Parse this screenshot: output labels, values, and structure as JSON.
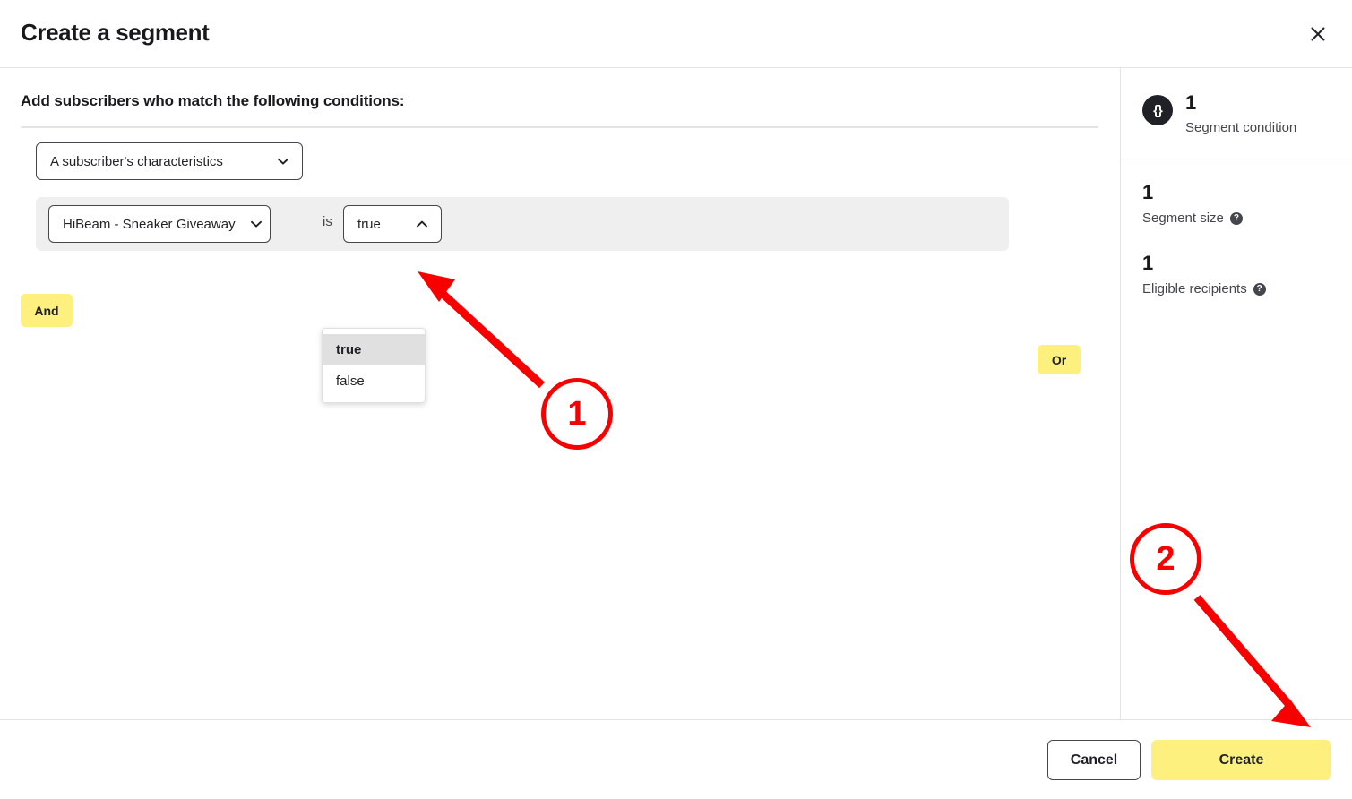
{
  "header": {
    "title": "Create a segment",
    "close_icon": "close-icon"
  },
  "main": {
    "section_heading": "Add subscribers who match the following conditions:",
    "subject_select": {
      "value": "A subscriber's characteristics",
      "chevron": "chevron-down-icon"
    },
    "condition": {
      "attribute_select": {
        "value": "HiBeam - Sneaker Giveaway",
        "chevron": "chevron-down-icon"
      },
      "operator_label": "is",
      "value_select": {
        "value": "true",
        "chevron": "chevron-up-icon",
        "expanded": true,
        "options": [
          {
            "label": "true",
            "selected": true
          },
          {
            "label": "false",
            "selected": false
          }
        ]
      },
      "or_label": "Or"
    },
    "and_label": "And"
  },
  "sidebar": {
    "condition_count": {
      "icon": "braces-icon",
      "icon_glyph": "{}",
      "value": "1",
      "label": "Segment condition"
    },
    "stats": [
      {
        "value": "1",
        "label": "Segment size",
        "help": "?"
      },
      {
        "value": "1",
        "label": "Eligible recipients",
        "help": "?"
      }
    ]
  },
  "footer": {
    "cancel_label": "Cancel",
    "create_label": "Create"
  },
  "annotations": [
    {
      "number": "1"
    },
    {
      "number": "2"
    }
  ],
  "colors": {
    "accent_yellow": "#fdf07f",
    "annotation_red": "#f90000",
    "row_gray": "#efefef",
    "dark": "#1f2127"
  }
}
